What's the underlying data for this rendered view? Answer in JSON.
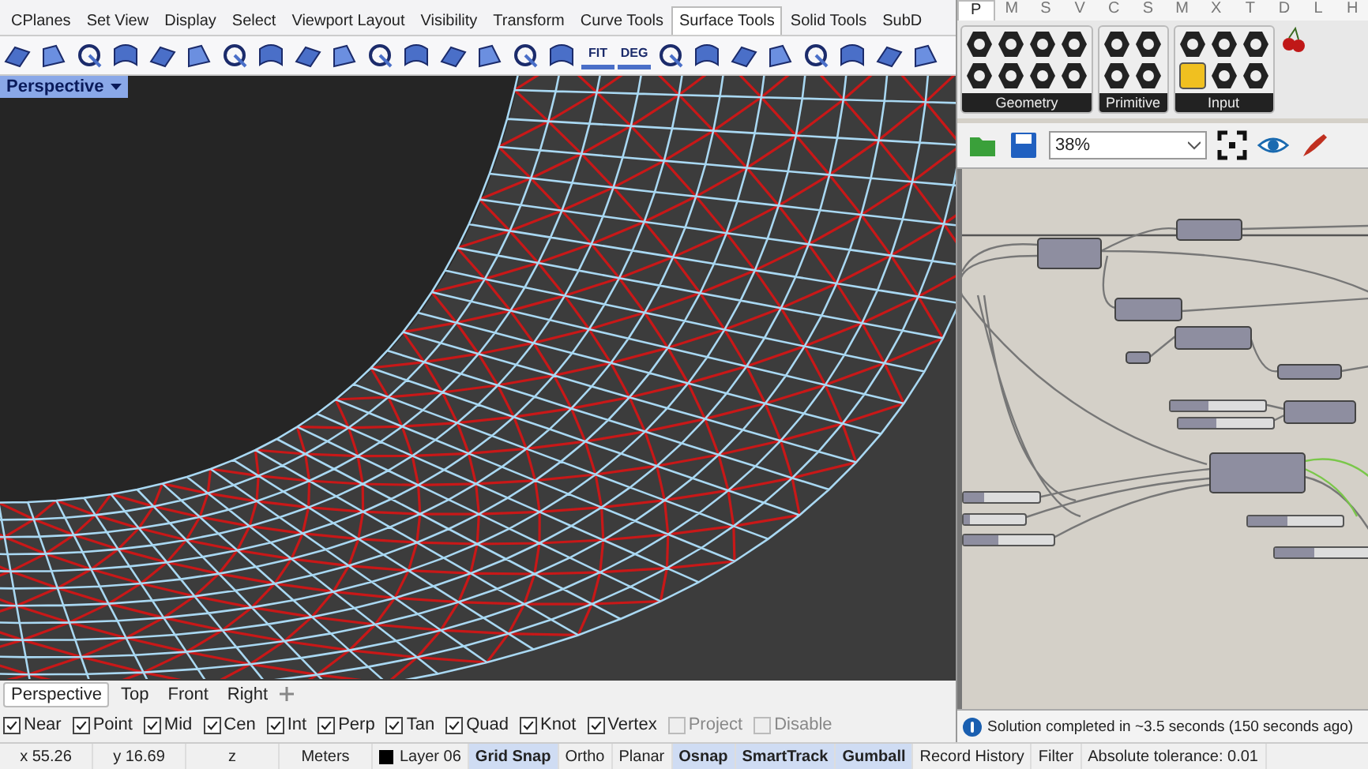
{
  "menu_tabs": [
    {
      "label": "CPlanes",
      "selected": false
    },
    {
      "label": "Set View",
      "selected": false
    },
    {
      "label": "Display",
      "selected": false
    },
    {
      "label": "Select",
      "selected": false
    },
    {
      "label": "Viewport Layout",
      "selected": false
    },
    {
      "label": "Visibility",
      "selected": false
    },
    {
      "label": "Transform",
      "selected": false
    },
    {
      "label": "Curve Tools",
      "selected": false
    },
    {
      "label": "Surface Tools",
      "selected": true
    },
    {
      "label": "Solid Tools",
      "selected": false
    },
    {
      "label": "SubD",
      "selected": false
    }
  ],
  "toolbar": [
    {
      "kind": "icon"
    },
    {
      "kind": "icon"
    },
    {
      "kind": "icon"
    },
    {
      "kind": "icon"
    },
    {
      "kind": "icon"
    },
    {
      "kind": "icon"
    },
    {
      "kind": "icon"
    },
    {
      "kind": "icon"
    },
    {
      "kind": "icon"
    },
    {
      "kind": "icon"
    },
    {
      "kind": "icon"
    },
    {
      "kind": "icon"
    },
    {
      "kind": "icon"
    },
    {
      "kind": "icon"
    },
    {
      "kind": "icon"
    },
    {
      "kind": "icon"
    },
    {
      "kind": "text",
      "label": "FIT"
    },
    {
      "kind": "text",
      "label": "DEG"
    },
    {
      "kind": "icon"
    },
    {
      "kind": "icon"
    },
    {
      "kind": "icon"
    },
    {
      "kind": "icon"
    },
    {
      "kind": "icon"
    },
    {
      "kind": "icon"
    },
    {
      "kind": "icon"
    },
    {
      "kind": "icon"
    }
  ],
  "viewport": {
    "title": "Perspective"
  },
  "viewport_tabs": [
    {
      "label": "Perspective",
      "selected": true
    },
    {
      "label": "Top",
      "selected": false
    },
    {
      "label": "Front",
      "selected": false
    },
    {
      "label": "Right",
      "selected": false
    }
  ],
  "osnaps": [
    {
      "label": "Near",
      "checked": true
    },
    {
      "label": "Point",
      "checked": true
    },
    {
      "label": "Mid",
      "checked": true
    },
    {
      "label": "Cen",
      "checked": true
    },
    {
      "label": "Int",
      "checked": true
    },
    {
      "label": "Perp",
      "checked": true
    },
    {
      "label": "Tan",
      "checked": true
    },
    {
      "label": "Quad",
      "checked": true
    },
    {
      "label": "Knot",
      "checked": true
    },
    {
      "label": "Vertex",
      "checked": true
    },
    {
      "label": "Project",
      "checked": false
    },
    {
      "label": "Disable",
      "checked": false
    }
  ],
  "grasshopper": {
    "tabs": [
      {
        "label": "P",
        "selected": true
      },
      {
        "label": "M",
        "selected": false
      },
      {
        "label": "S",
        "selected": false
      },
      {
        "label": "V",
        "selected": false
      },
      {
        "label": "C",
        "selected": false
      },
      {
        "label": "S",
        "selected": false
      },
      {
        "label": "M",
        "selected": false
      },
      {
        "label": "X",
        "selected": false
      },
      {
        "label": "T",
        "selected": false
      },
      {
        "label": "D",
        "selected": false
      },
      {
        "label": "L",
        "selected": false
      },
      {
        "label": "H",
        "selected": false
      }
    ],
    "groups": [
      {
        "label": "Geometry"
      },
      {
        "label": "Primitive"
      },
      {
        "label": "Input"
      }
    ],
    "zoom": {
      "value": "38%"
    },
    "sliders": [
      {
        "level": 0.4
      },
      {
        "level": 0.4
      },
      {
        "level": 0.28
      },
      {
        "level": 0.1
      },
      {
        "level": 0.38
      },
      {
        "level": 0.42
      },
      {
        "level": 0.42
      }
    ],
    "message": "Solution completed in ~3.5 seconds (150 seconds ago)"
  },
  "status_bar": [
    {
      "text": "x 55.26",
      "on": false
    },
    {
      "text": "y 16.69",
      "on": false
    },
    {
      "text": "z",
      "on": false
    },
    {
      "text": "Meters",
      "on": false
    },
    {
      "text": "Layer 06",
      "on": false,
      "color": "#000000"
    },
    {
      "text": "Grid Snap",
      "on": true
    },
    {
      "text": "Ortho",
      "on": false
    },
    {
      "text": "Planar",
      "on": false
    },
    {
      "text": "Osnap",
      "on": true
    },
    {
      "text": "SmartTrack",
      "on": true
    },
    {
      "text": "Gumball",
      "on": true
    },
    {
      "text": "Record History",
      "on": false
    },
    {
      "text": "Filter",
      "on": false
    },
    {
      "text": "Absolute tolerance: 0.01",
      "on": false
    }
  ]
}
